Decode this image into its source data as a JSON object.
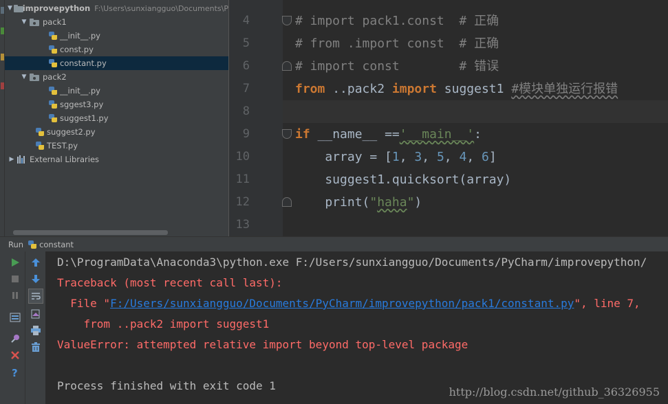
{
  "project_tree": {
    "root": {
      "name": "improvepython",
      "path": "F:\\Users\\sunxiangguo\\Documents\\P"
    },
    "items": [
      {
        "label": "pack1",
        "kind": "package"
      },
      {
        "label": "__init__.py",
        "kind": "file"
      },
      {
        "label": "const.py",
        "kind": "file"
      },
      {
        "label": "constant.py",
        "kind": "file"
      },
      {
        "label": "pack2",
        "kind": "package"
      },
      {
        "label": "__init__.py",
        "kind": "file"
      },
      {
        "label": "sggest3.py",
        "kind": "file"
      },
      {
        "label": "suggest1.py",
        "kind": "file"
      },
      {
        "label": "suggest2.py",
        "kind": "file"
      },
      {
        "label": "TEST.py",
        "kind": "file"
      },
      {
        "label": "External Libraries",
        "kind": "libraries"
      }
    ],
    "selected": "constant.py"
  },
  "editor": {
    "line_numbers": [
      "4",
      "5",
      "6",
      "7",
      "8",
      "9",
      "10",
      "11",
      "12",
      "13"
    ],
    "line4_comment": "# import pack1.const  # 正确",
    "line5_comment": "# from .import const  # 正确",
    "line6_comment": "# import const        # 错误",
    "line7": {
      "from": "from",
      "module": " ..pack2 ",
      "import": "import",
      "name": " suggest1 ",
      "comment": "#模块单独运行报错"
    },
    "line9": {
      "if": "if",
      "dunder": " __name__ ",
      "op": "==",
      "str": "'__main__'",
      "colon": ":"
    },
    "line10": {
      "a": "    array = [",
      "n1": "1",
      "c1": ", ",
      "n2": "3",
      "c2": ", ",
      "n3": "5",
      "c3": ", ",
      "n4": "4",
      "c4": ", ",
      "n5": "6",
      "end": "]"
    },
    "line11": "    suggest1.quicksort(array)",
    "line12": {
      "a": "    print(",
      "q1": "\"",
      "str": "haha",
      "q2": "\"",
      "end": ")"
    }
  },
  "run_panel": {
    "label": "Run",
    "config_name": "constant"
  },
  "console": {
    "cmd": "D:\\ProgramData\\Anaconda3\\python.exe F:/Users/sunxiangguo/Documents/PyCharm/improvepython/",
    "traceback": "Traceback (most recent call last):",
    "file_prefix": "  File \"",
    "file_link": "F:/Users/sunxiangguo/Documents/PyCharm/improvepython/pack1/constant.py",
    "file_suffix": "\", line 7,",
    "code_line": "    from ..pack2 import suggest1",
    "error": "ValueError: attempted relative import beyond top-level package",
    "exit": "Process finished with exit code 1"
  },
  "watermark": "http://blog.csdn.net/github_36326955",
  "colors": {
    "keyword": "#cc7832",
    "comment": "#808080",
    "string": "#6a8759",
    "number": "#6897bb",
    "error": "#ff6b68",
    "link": "#287bde"
  }
}
